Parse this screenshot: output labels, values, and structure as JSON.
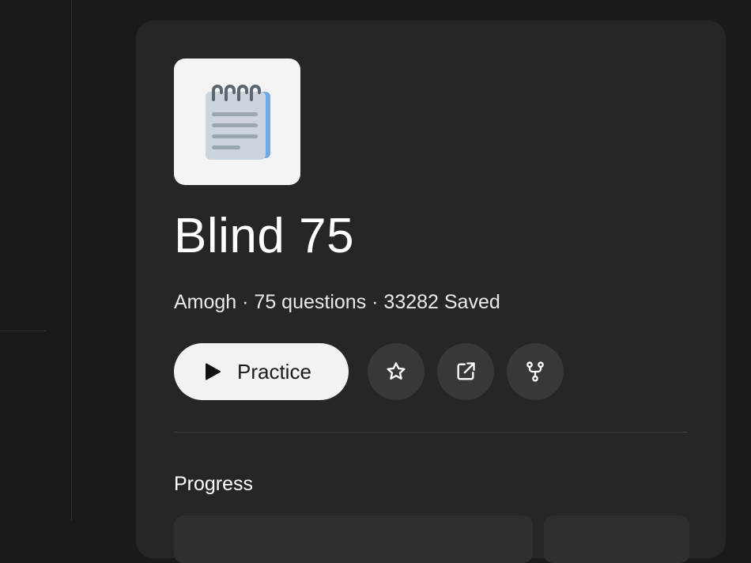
{
  "list": {
    "title": "Blind 75",
    "meta": "Amogh · 75 questions · 33282 Saved",
    "cover_icon": "notepad-icon"
  },
  "actions": {
    "practice_label": "Practice",
    "practice_icon": "play-icon",
    "star_icon": "star-icon",
    "share_icon": "external-link-icon",
    "fork_icon": "fork-icon"
  },
  "progress": {
    "heading": "Progress"
  },
  "theme": {
    "background": "#1a1a1a",
    "card": "#262626",
    "button_light": "#f2f2f2",
    "button_dark": "#383838"
  }
}
